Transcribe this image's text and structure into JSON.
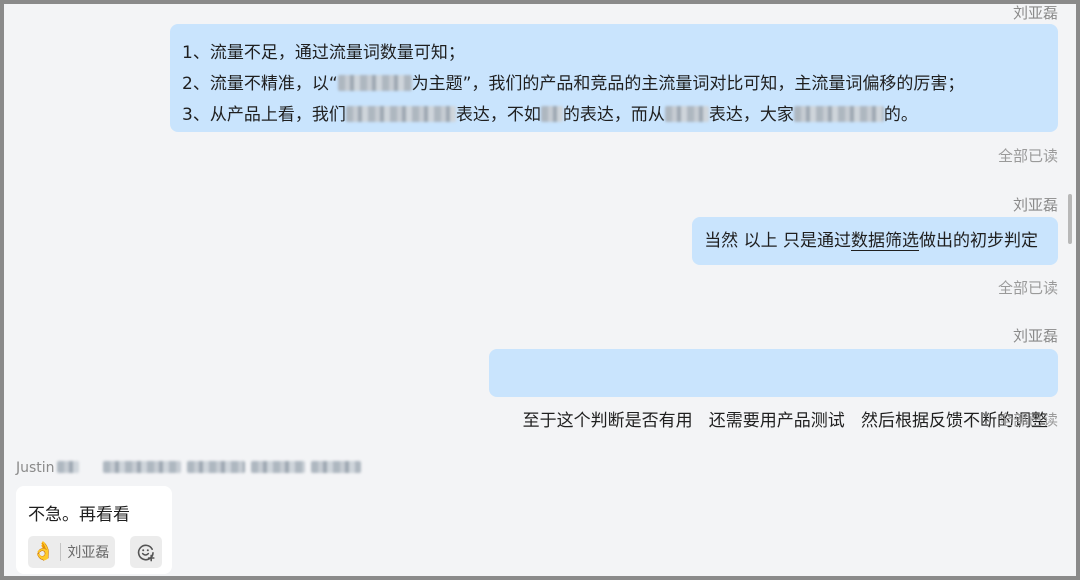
{
  "messages": [
    {
      "sender": "刘亚磊",
      "lines": [
        {
          "before": "1、流量不足，通过流量词数量可知；"
        },
        {
          "before": "2、流量不精准，以“",
          "mid": "为主题”，我们的产品和竞品的主流量词对比可知，主流量词偏移的厉害；"
        },
        {
          "before": "3、从产品上看，我们",
          "mid": "表达，不如",
          "mid2": "的表达，而从",
          "mid3": "表达，大家",
          "after": "的。"
        }
      ],
      "status": "全部已读"
    },
    {
      "sender": "刘亚磊",
      "text_before": "当然  以上  只是通过",
      "text_underlined": "数据筛选",
      "text_after": "做出的初步判定",
      "status": "全部已读"
    },
    {
      "sender": "刘亚磊",
      "text": "至于这个判断是否有用   还需要用产品测试   然后根据反馈不断的调整",
      "status": "全部已读"
    }
  ],
  "incoming": {
    "sender_name": "Justin",
    "text": "不急。再看看",
    "reaction": {
      "icon": "ok-hand-icon",
      "emoji": "👌",
      "user": "刘亚磊"
    },
    "add_reaction_icon": "add-emoji-icon"
  },
  "colors": {
    "outgoing_bubble": "#c9e4fd",
    "incoming_bubble": "#ffffff",
    "background": "#f3f4f6",
    "meta_text": "#8a8a8a"
  }
}
